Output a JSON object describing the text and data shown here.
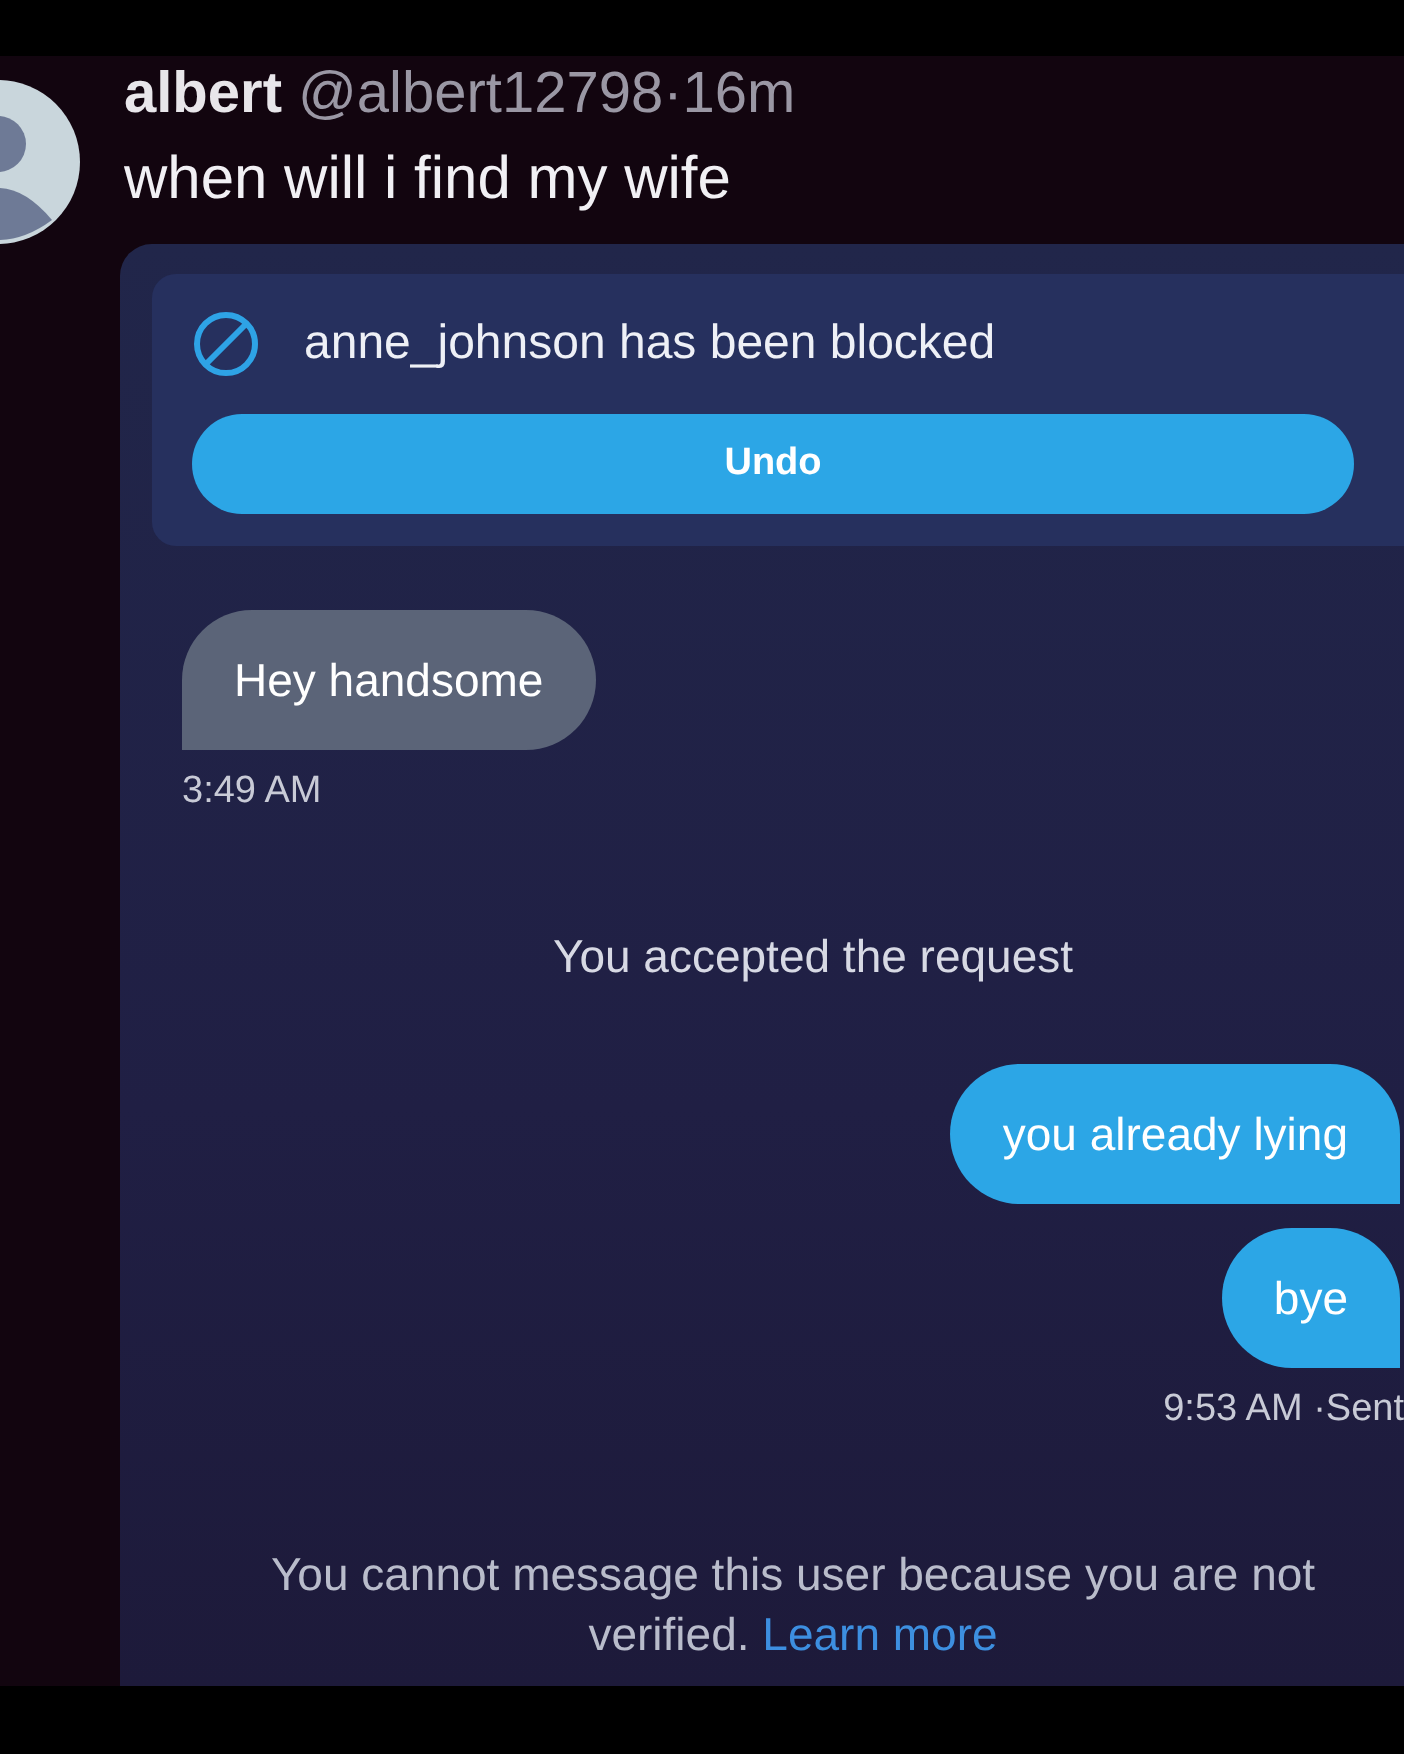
{
  "post": {
    "author": "albert",
    "handle": "@albert12798",
    "time": "16m",
    "separator": "·",
    "text": "when will i find my wife"
  },
  "dm_screenshot": {
    "banner": {
      "text": "anne_johnson has been blocked",
      "button": "Undo"
    },
    "messages": [
      {
        "kind": "received",
        "text": "Hey handsome",
        "timestamp": "3:49 AM"
      },
      {
        "kind": "system",
        "text": "You accepted the request"
      },
      {
        "kind": "sent",
        "text": "you already lying"
      },
      {
        "kind": "sent",
        "text": "bye",
        "timestamp": "9:53 AM ·Sent"
      }
    ],
    "notice": {
      "text": "You cannot message this user because you are not verified.",
      "link": "Learn more"
    }
  }
}
